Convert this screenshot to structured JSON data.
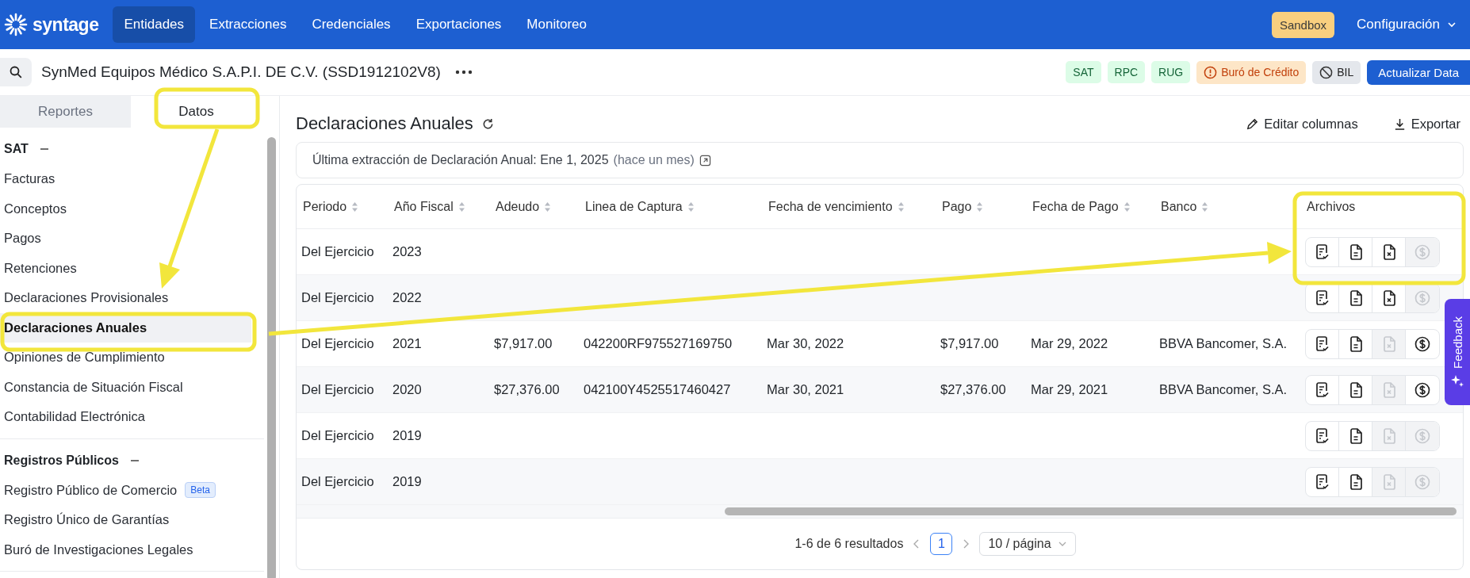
{
  "nav": {
    "logo": "syntage",
    "tabs": [
      {
        "label": "Entidades",
        "selected": true
      },
      {
        "label": "Extracciones",
        "selected": false
      },
      {
        "label": "Credenciales",
        "selected": false
      },
      {
        "label": "Exportaciones",
        "selected": false
      },
      {
        "label": "Monitoreo",
        "selected": false
      }
    ],
    "environment_badge": "Sandbox",
    "settings_menu": "Configuración"
  },
  "entity": {
    "name": "SynMed Equipos Médico S.A.P.I. DE C.V. (SSD1912102V8)",
    "sources": [
      {
        "label": "SAT",
        "kind": "ok"
      },
      {
        "label": "RPC",
        "kind": "ok"
      },
      {
        "label": "RUG",
        "kind": "ok"
      },
      {
        "label": "Buró de Crédito",
        "kind": "warning"
      },
      {
        "label": "BIL",
        "kind": "blocked"
      }
    ],
    "update_button": "Actualizar Data"
  },
  "sidebar": {
    "tabs": [
      {
        "label": "Reportes",
        "selected": false
      },
      {
        "label": "Datos",
        "selected": true
      }
    ],
    "sections": [
      {
        "title": "SAT",
        "expanded": true,
        "items": [
          {
            "label": "Facturas",
            "selected": false
          },
          {
            "label": "Conceptos",
            "selected": false
          },
          {
            "label": "Pagos",
            "selected": false
          },
          {
            "label": "Retenciones",
            "selected": false
          },
          {
            "label": "Declaraciones Provisionales",
            "selected": false
          },
          {
            "label": "Declaraciones Anuales",
            "selected": true
          },
          {
            "label": "Opiniones de Cumplimiento",
            "selected": false
          },
          {
            "label": "Constancia de Situación Fiscal",
            "selected": false
          },
          {
            "label": "Contabilidad Electrónica",
            "selected": false
          }
        ]
      },
      {
        "title": "Registros Públicos",
        "expanded": true,
        "items": [
          {
            "label": "Registro Público de Comercio",
            "badge": "Beta",
            "selected": false
          },
          {
            "label": "Registro Único de Garantías",
            "selected": false
          },
          {
            "label": "Buró de Investigaciones Legales",
            "selected": false
          }
        ]
      }
    ]
  },
  "page": {
    "title": "Declaraciones Anuales",
    "actions": [
      {
        "label": "Editar columnas",
        "kind": "edit"
      },
      {
        "label": "Exportar",
        "kind": "export"
      }
    ],
    "last_extraction": "Última extracción de Declaración Anual: Ene 1, 2025",
    "last_extraction_relative": "(hace un mes)"
  },
  "table": {
    "columns": [
      {
        "label": "Periodo",
        "sortable": true
      },
      {
        "label": "Año Fiscal",
        "sortable": true
      },
      {
        "label": "Adeudo",
        "sortable": true
      },
      {
        "label": "Linea de Captura",
        "sortable": true
      },
      {
        "label": "Fecha de vencimiento",
        "sortable": true
      },
      {
        "label": "Pago",
        "sortable": true
      },
      {
        "label": "Fecha de Pago",
        "sortable": true
      },
      {
        "label": "Banco",
        "sortable": true
      },
      {
        "label": "Archivos",
        "sortable": false
      }
    ],
    "rows": [
      {
        "cells": [
          "Del Ejercicio",
          "2023"
        ],
        "files": [
          {
            "kind": "acknowledgment",
            "disabled": false
          },
          {
            "kind": "declaration",
            "disabled": false
          },
          {
            "kind": "excel",
            "disabled": false
          },
          {
            "kind": "payment",
            "disabled": true
          }
        ]
      },
      {
        "cells": [
          "Del Ejercicio",
          "2022"
        ],
        "files": [
          {
            "kind": "acknowledgment",
            "disabled": false
          },
          {
            "kind": "declaration",
            "disabled": false
          },
          {
            "kind": "excel",
            "disabled": false
          },
          {
            "kind": "payment",
            "disabled": true
          }
        ]
      },
      {
        "cells": [
          "Del Ejercicio",
          "2021",
          "$7,917.00",
          "042200RF975527169750",
          "Mar 30, 2022",
          "$7,917.00",
          "Mar 29, 2022",
          "BBVA Bancomer, S.A."
        ],
        "files": [
          {
            "kind": "acknowledgment",
            "disabled": false
          },
          {
            "kind": "declaration",
            "disabled": false
          },
          {
            "kind": "excel",
            "disabled": true
          },
          {
            "kind": "payment",
            "disabled": false
          }
        ]
      },
      {
        "cells": [
          "Del Ejercicio",
          "2020",
          "$27,376.00",
          "042100Y4525517460427",
          "Mar 30, 2021",
          "$27,376.00",
          "Mar 29, 2021",
          "BBVA Bancomer, S.A."
        ],
        "files": [
          {
            "kind": "acknowledgment",
            "disabled": false
          },
          {
            "kind": "declaration",
            "disabled": false
          },
          {
            "kind": "excel",
            "disabled": true
          },
          {
            "kind": "payment",
            "disabled": false
          }
        ]
      },
      {
        "cells": [
          "Del Ejercicio",
          "2019"
        ],
        "files": [
          {
            "kind": "acknowledgment",
            "disabled": false
          },
          {
            "kind": "declaration",
            "disabled": false
          },
          {
            "kind": "excel",
            "disabled": true
          },
          {
            "kind": "payment",
            "disabled": true
          }
        ]
      },
      {
        "cells": [
          "Del Ejercicio",
          "2019"
        ],
        "files": [
          {
            "kind": "acknowledgment",
            "disabled": false
          },
          {
            "kind": "declaration",
            "disabled": false
          },
          {
            "kind": "excel",
            "disabled": true
          },
          {
            "kind": "payment",
            "disabled": true
          }
        ]
      }
    ]
  },
  "pagination": {
    "summary": "1-6 de 6 resultados",
    "pages": [
      {
        "label": "1",
        "selected": true
      }
    ],
    "page_size": "10 / página"
  },
  "feedback_tab": "Feedback"
}
